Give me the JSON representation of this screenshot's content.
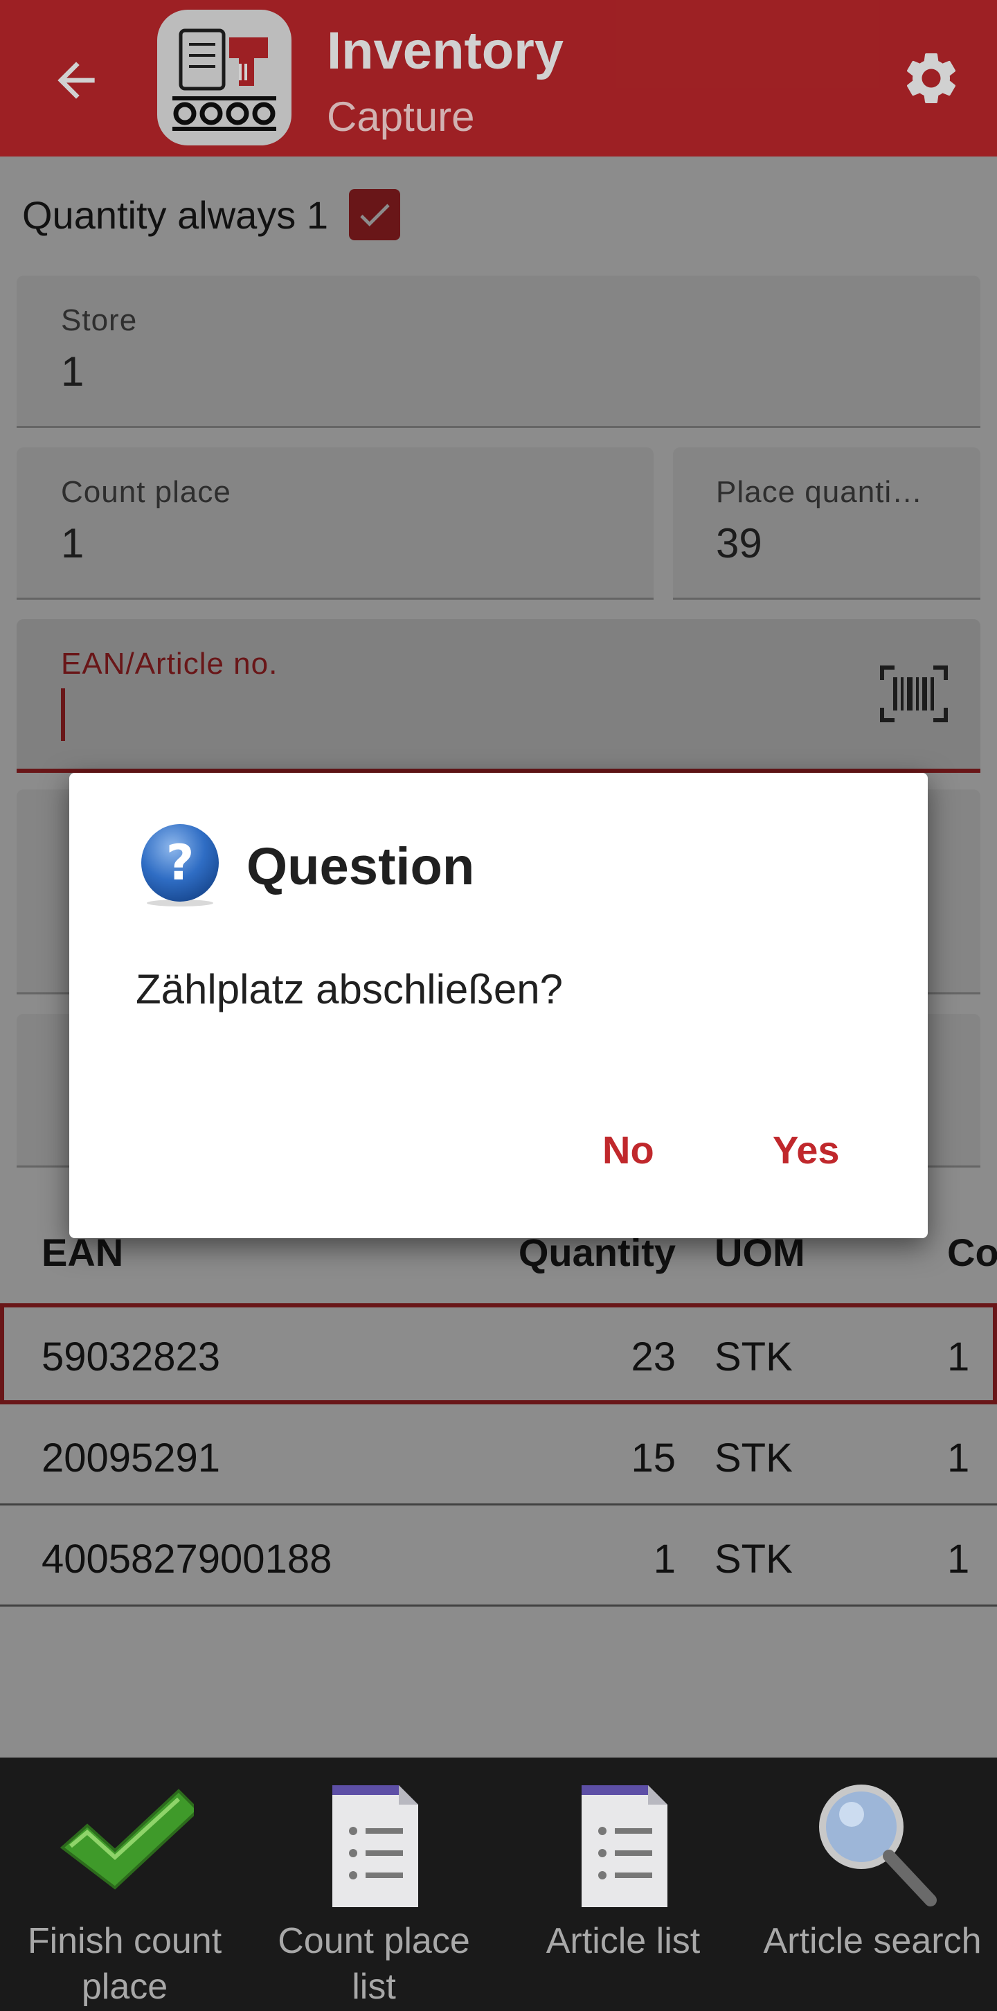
{
  "header": {
    "title": "Inventory",
    "subtitle": "Capture",
    "back_icon": "arrow-left-icon",
    "settings_icon": "gear-icon",
    "logo_icon": "inventory-scanner-logo",
    "color": "#c0282c"
  },
  "form": {
    "quantity_always_1_label": "Quantity always 1",
    "quantity_always_1_checked": true,
    "store": {
      "label": "Store",
      "value": "1"
    },
    "count_place": {
      "label": "Count place",
      "value": "1"
    },
    "place_quantity": {
      "label": "Place quanti…",
      "value": "39"
    },
    "ean_article": {
      "label": "EAN/Article no.",
      "value": ""
    }
  },
  "table": {
    "headers": [
      "EAN",
      "Quantity",
      "UOM",
      "Co"
    ],
    "rows": [
      {
        "ean": "59032823",
        "quantity": "23",
        "uom": "STK",
        "count": "1",
        "selected": true
      },
      {
        "ean": "20095291",
        "quantity": "15",
        "uom": "STK",
        "count": "1",
        "selected": false
      },
      {
        "ean": "4005827900188",
        "quantity": "1",
        "uom": "STK",
        "count": "1",
        "selected": false
      }
    ]
  },
  "dialog": {
    "icon": "question-icon",
    "title": "Question",
    "message": "Zählplatz abschließen?",
    "no_label": "No",
    "yes_label": "Yes"
  },
  "bottom_nav": {
    "items": [
      {
        "label_line1": "Finish count",
        "label_line2": "place",
        "icon": "checkmark-icon"
      },
      {
        "label_line1": "Count place",
        "label_line2": "list",
        "icon": "document-list-icon"
      },
      {
        "label_line1": "Article list",
        "label_line2": "",
        "icon": "document-list-icon"
      },
      {
        "label_line1": "Article search",
        "label_line2": "",
        "icon": "magnifier-icon"
      }
    ]
  }
}
